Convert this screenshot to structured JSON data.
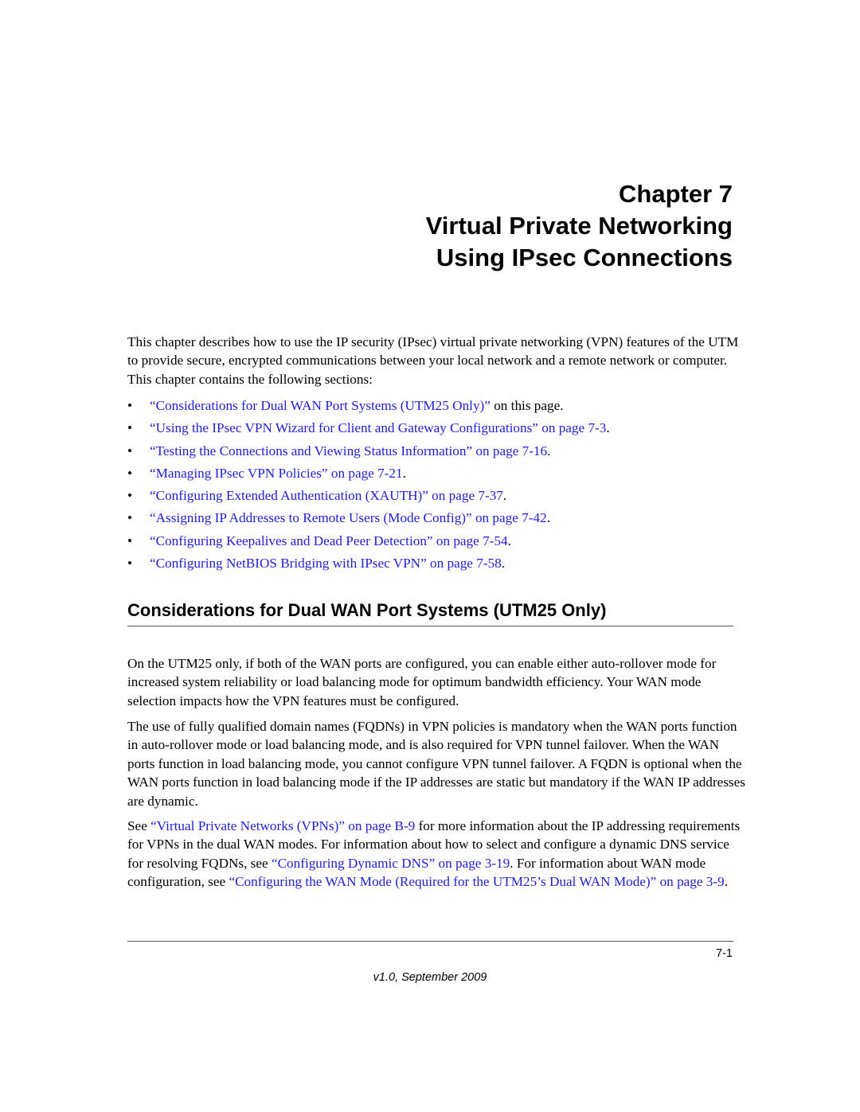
{
  "chapter": {
    "number_line": "Chapter 7",
    "title_line1": "Virtual Private Networking",
    "title_line2": "Using IPsec Connections"
  },
  "intro": "This chapter describes how to use the IP security (IPsec) virtual private networking (VPN) features of the UTM to provide secure, encrypted communications between your local network and a remote network or computer. This chapter contains the following sections:",
  "toc": [
    {
      "link": "“Considerations for Dual WAN Port Systems (UTM25 Only)”",
      "suffix": " on this page."
    },
    {
      "link": "“Using the IPsec VPN Wizard for Client and Gateway Configurations” on page 7-3",
      "suffix": "."
    },
    {
      "link": "“Testing the Connections and Viewing Status Information” on page 7-16",
      "suffix": "."
    },
    {
      "link": "“Managing IPsec VPN Policies” on page 7-21",
      "suffix": "."
    },
    {
      "link": "“Configuring Extended Authentication (XAUTH)” on page 7-37",
      "suffix": "."
    },
    {
      "link": "“Assigning IP Addresses to Remote Users (Mode Config)” on page 7-42",
      "suffix": "."
    },
    {
      "link": "“Configuring Keepalives and Dead Peer Detection” on page 7-54",
      "suffix": "."
    },
    {
      "link": "“Configuring NetBIOS Bridging with IPsec VPN” on page 7-58",
      "suffix": "."
    }
  ],
  "bullet": "•",
  "section": {
    "heading": "Considerations for Dual WAN Port Systems (UTM25 Only)",
    "p1": "On the UTM25 only, if both of the WAN ports are configured, you can enable either auto-rollover mode for increased system reliability or load balancing mode for optimum bandwidth efficiency. Your WAN mode selection impacts how the VPN features must be configured.",
    "p2": "The use of fully qualified domain names (FQDNs) in VPN policies is mandatory when the WAN ports function in auto-rollover mode or load balancing mode, and is also required for VPN tunnel failover. When the WAN ports function in load balancing mode, you cannot configure VPN tunnel failover. A FQDN is optional when the WAN ports function in load balancing mode if the IP addresses are static but mandatory if the WAN IP addresses are dynamic.",
    "p3": {
      "t1": "See ",
      "l1": "“Virtual Private Networks (VPNs)” on page B-9",
      "t2": " for more information about the IP addressing requirements for VPNs in the dual WAN modes. For information about how to select and configure a dynamic DNS service for resolving FQDNs, see ",
      "l2": "“Configuring Dynamic DNS” on page 3-19",
      "t3": ". For information about WAN mode configuration, see ",
      "l3": "“Configuring the WAN Mode (Required for the UTM25’s Dual WAN Mode)” on page 3-9",
      "t4": "."
    }
  },
  "footer": {
    "page_number": "7-1",
    "version": "v1.0, September 2009"
  }
}
